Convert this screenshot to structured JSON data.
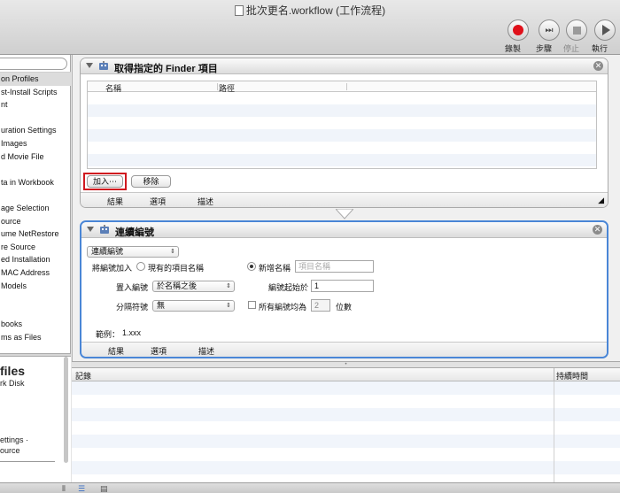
{
  "window": {
    "title": "批次更名.workflow (工作流程)"
  },
  "toolbar": {
    "record": {
      "label": "錄製"
    },
    "step": {
      "label": "步驟"
    },
    "stop": {
      "label": "停止"
    },
    "run": {
      "label": "執行"
    },
    "record_color": "#e0101a"
  },
  "sidebar": {
    "items": [
      "on Profiles",
      "st-Install Scripts",
      "nt",
      "",
      "uration Settings",
      "Images",
      "d Movie File",
      "",
      "ta in Workbook",
      "",
      "age Selection",
      "ource",
      "ume NetRestore",
      "re Source",
      "ed Installation",
      "MAC Address",
      "Models",
      "",
      "",
      "books",
      "ms as Files"
    ],
    "description": {
      "heading": "files",
      "line1": "rk Disk",
      "line2": "ettings ·",
      "line3": "ource"
    }
  },
  "action1": {
    "title": "取得指定的 Finder 項目",
    "columns": [
      "名稱",
      "路徑"
    ],
    "add_button": "加入⋯",
    "remove_button": "移除",
    "footer": [
      "結果",
      "選項",
      "描述"
    ]
  },
  "action2": {
    "title": "連續編號",
    "mode_popup": "連續編號",
    "add_number_to_label": "將編號加入",
    "existing_name_option": "現有的項目名稱",
    "new_name_option": "新增名稱",
    "new_name_placeholder": "項目名稱",
    "place_number_label": "置入編號",
    "place_number_value": "於名稱之後",
    "start_number_label": "編號起始於",
    "start_number_value": "1",
    "separator_label": "分隔符號",
    "separator_value": "無",
    "digits_checkbox_label": "所有編號均為",
    "digits_value": "2",
    "digits_unit": "位數",
    "example_label": "範例：",
    "example_value": "1.xxx",
    "footer": [
      "結果",
      "選項",
      "描述"
    ],
    "selection_color": "#4a86d6"
  },
  "log": {
    "columns": [
      "記錄",
      "持續時間"
    ]
  },
  "icons": [
    "document-icon",
    "record-icon",
    "step-icon",
    "stop-icon",
    "play-icon",
    "automator-robot-icon",
    "close-icon",
    "disclosure-triangle-icon",
    "list-view-icon",
    "workflow-view-icon"
  ]
}
